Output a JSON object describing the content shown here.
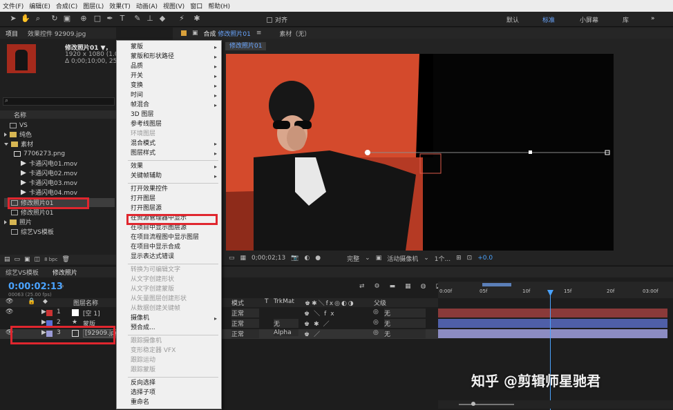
{
  "menubar": [
    "文件(F)",
    "编辑(E)",
    "合成(C)",
    "图层(L)",
    "效果(T)",
    "动画(A)",
    "视图(V)",
    "窗口",
    "帮助(H)"
  ],
  "toolbar": {
    "snap": "对齐",
    "workspaces": [
      "默认",
      "标准",
      "小屏幕",
      "库"
    ],
    "active_workspace": "标准"
  },
  "project": {
    "tab": "项目",
    "effects_tab": "效果控件 92909.jpg",
    "item_name": "修改照片01 ▼，",
    "item_size": "1920 x 1080 (1.00)",
    "item_duration": "Δ 0;00;10;00, 25.00 fps",
    "col_name": "名称",
    "rows": [
      {
        "name": "VS",
        "type": "comp"
      },
      {
        "name": "纯色",
        "type": "folder"
      },
      {
        "name": "素材",
        "type": "folder-open"
      },
      {
        "name": "7706273.png",
        "type": "file"
      },
      {
        "name": "卡通闪电01.mov",
        "type": "video"
      },
      {
        "name": "卡通闪电02.mov",
        "type": "video"
      },
      {
        "name": "卡通闪电03.mov",
        "type": "video"
      },
      {
        "name": "卡通闪电04.mov",
        "type": "video"
      },
      {
        "name": "修改照片01",
        "type": "comp"
      },
      {
        "name": "修改照片01",
        "type": "comp"
      },
      {
        "name": "照片",
        "type": "folder"
      },
      {
        "name": "综艺VS模板",
        "type": "comp"
      }
    ],
    "bpc": "8 bpc"
  },
  "comp": {
    "tab_prefix": "合成",
    "tab_name": "修改照片01",
    "footage_tab": "素材（无）",
    "breadcrumb": "修改照片01",
    "timecode": "0;00;02;13",
    "quality": "完整",
    "camera": "活动摄像机",
    "views": "1个...",
    "exposure": "+0.0"
  },
  "context_menu": {
    "items": [
      {
        "label": "蒙版",
        "sub": true
      },
      {
        "label": "蒙版和形状路径",
        "sub": true
      },
      {
        "label": "品质",
        "sub": true
      },
      {
        "label": "开关",
        "sub": true
      },
      {
        "label": "变换",
        "sub": true
      },
      {
        "label": "时间",
        "sub": true
      },
      {
        "label": "帧混合",
        "sub": true
      },
      {
        "label": "3D 图层"
      },
      {
        "label": "参考线图层"
      },
      {
        "label": "环境图层",
        "disabled": true
      },
      {
        "label": "混合模式",
        "sub": true
      },
      {
        "label": "图层样式",
        "sub": true
      },
      {
        "sep": true
      },
      {
        "label": "效果",
        "sub": true
      },
      {
        "label": "关键帧辅助",
        "sub": true
      },
      {
        "sep": true
      },
      {
        "label": "打开效果控件"
      },
      {
        "label": "打开图层"
      },
      {
        "label": "打开图层源"
      },
      {
        "label": "在资源管理器中显示"
      },
      {
        "label": "在项目中显示图层源"
      },
      {
        "label": "在项目流程图中显示图层"
      },
      {
        "label": "在项目中显示合成"
      },
      {
        "label": "显示表达式错误"
      },
      {
        "sep": true
      },
      {
        "label": "转换为可编辑文字",
        "disabled": true
      },
      {
        "label": "从文字创建形状",
        "disabled": true
      },
      {
        "label": "从文字创建蒙版",
        "disabled": true
      },
      {
        "label": "从矢量图层创建形状",
        "disabled": true
      },
      {
        "label": "从数据创建关键帧",
        "disabled": true
      },
      {
        "label": "摄像机",
        "sub": true
      },
      {
        "label": "预合成..."
      },
      {
        "sep": true
      },
      {
        "label": "跟踪摄像机",
        "disabled": true
      },
      {
        "label": "变形稳定器 VFX",
        "disabled": true
      },
      {
        "label": "跟踪运动",
        "disabled": true
      },
      {
        "label": "跟踪蒙版",
        "disabled": true
      },
      {
        "sep": true
      },
      {
        "label": "反向选择"
      },
      {
        "label": "选择子项"
      },
      {
        "label": "重命名"
      }
    ]
  },
  "timeline": {
    "tabs": [
      "综艺VS模板",
      "修改照片"
    ],
    "timecode": "0:00:02:13",
    "frames": "00063 (25.00 fps)",
    "col_layer_name": "图层名称",
    "col_mode": "模式",
    "col_t": "T",
    "col_trkmat": "TrkMat",
    "col_parent": "父级",
    "layers": [
      {
        "num": "1",
        "name": "[空 1]",
        "color": "#c33",
        "mode": "正常",
        "trk": "",
        "parent": "无"
      },
      {
        "num": "2",
        "name": "蒙版",
        "color": "#5a6fd6",
        "mode": "正常",
        "trk": "无",
        "parent": "无"
      },
      {
        "num": "3",
        "name": "[92909.jpg]",
        "color": "#9b9bd6",
        "mode": "正常",
        "trk": "Alpha",
        "parent": "无"
      }
    ],
    "ruler": [
      "0:00f",
      "05f",
      "10f",
      "15f",
      "20f",
      "03:00f"
    ]
  },
  "watermark": "知乎 @剪辑师星驰君",
  "colors": {
    "accent": "#6aa6ff",
    "highlight_red": "#e0262e",
    "timecode": "#4aa3ff"
  }
}
